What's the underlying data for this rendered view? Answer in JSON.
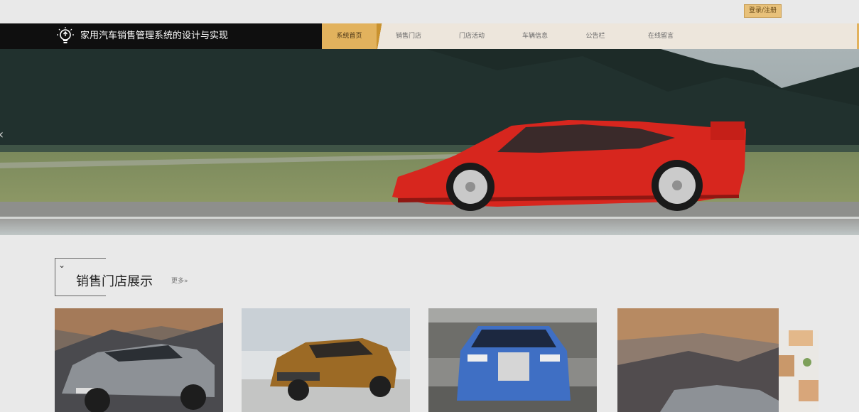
{
  "topbar": {
    "login_label": "登录/注册"
  },
  "header": {
    "title": "家用汽车销售管理系统的设计与实现",
    "nav": [
      {
        "label": "系统首页",
        "active": true
      },
      {
        "label": "销售门店",
        "active": false
      },
      {
        "label": "门店活动",
        "active": false
      },
      {
        "label": "车辆信息",
        "active": false
      },
      {
        "label": "公告栏",
        "active": false
      },
      {
        "label": "在线留言",
        "active": false
      }
    ]
  },
  "banner": {
    "image": "red-sports-car-on-track",
    "prev_icon": "chevron-left-icon"
  },
  "section": {
    "title": "销售门店展示",
    "more_label": "更多»"
  },
  "cards": [
    {
      "image": "grey-electric-suv-mountains"
    },
    {
      "image": "bronze-suv-studio"
    },
    {
      "image": "blue-luxury-sedan-front"
    },
    {
      "image": "suv-sunset-mountains"
    }
  ],
  "colors": {
    "accent": "#e2b25d",
    "header_dark": "#0f0f0f",
    "nav_bg": "#ede6dc",
    "page_bg": "#e9e9e9"
  }
}
